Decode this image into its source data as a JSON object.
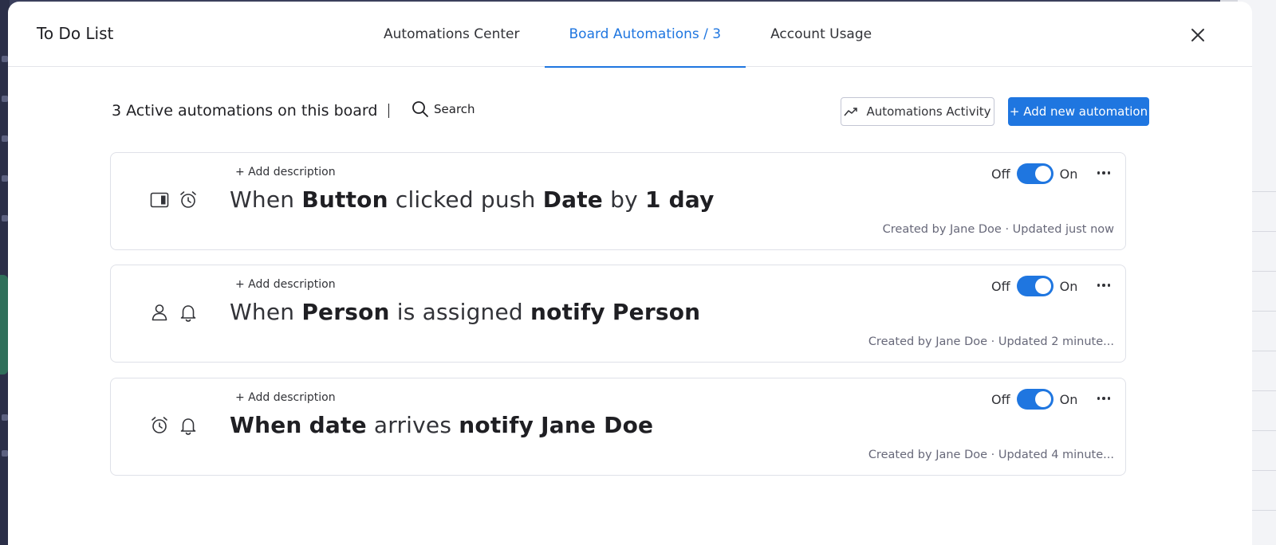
{
  "modal": {
    "board_title": "To Do List",
    "tabs": [
      {
        "label": "Automations Center"
      },
      {
        "label": "Board Automations / 3"
      },
      {
        "label": "Account Usage"
      }
    ],
    "active_tab": "Board Automations / 3"
  },
  "toolbar": {
    "active_count": "3 Active automations on this board",
    "search_label": "Search",
    "activity_label": "Automations Activity",
    "add_label": "+ Add new automation"
  },
  "automations": [
    {
      "icons": [
        "panel-icon",
        "alarm-clock-icon"
      ],
      "add_description": "+ Add description",
      "sentence": [
        {
          "text": "When",
          "bold": false
        },
        {
          "text": "Button",
          "bold": true
        },
        {
          "text": "clicked push",
          "bold": false
        },
        {
          "text": "Date",
          "bold": true
        },
        {
          "text": "by",
          "bold": false
        },
        {
          "text": "1 day",
          "bold": true
        }
      ],
      "off_label": "Off",
      "on_label": "On",
      "enabled": true,
      "meta": "Created by Jane Doe · Updated just now"
    },
    {
      "icons": [
        "person-icon",
        "bell-icon"
      ],
      "add_description": "+ Add description",
      "sentence": [
        {
          "text": "When",
          "bold": false
        },
        {
          "text": "Person",
          "bold": true
        },
        {
          "text": "is assigned",
          "bold": false
        },
        {
          "text": "notify",
          "bold": true
        },
        {
          "text": "Person",
          "bold": true
        }
      ],
      "off_label": "Off",
      "on_label": "On",
      "enabled": true,
      "meta": "Created by Jane Doe · Updated 2 minute..."
    },
    {
      "icons": [
        "alarm-clock-icon",
        "bell-icon"
      ],
      "add_description": "+ Add description",
      "sentence": [
        {
          "text": "When",
          "bold": true
        },
        {
          "text": "date",
          "bold": true
        },
        {
          "text": "arrives",
          "bold": false
        },
        {
          "text": "notify",
          "bold": true
        },
        {
          "text": "Jane Doe",
          "bold": true
        }
      ],
      "off_label": "Off",
      "on_label": "On",
      "enabled": true,
      "meta": "Created by Jane Doe · Updated 4 minute..."
    }
  ],
  "colors": {
    "accent": "#1f76e0",
    "text": "#323338",
    "muted": "#676879",
    "border": "#dfe1e8"
  }
}
